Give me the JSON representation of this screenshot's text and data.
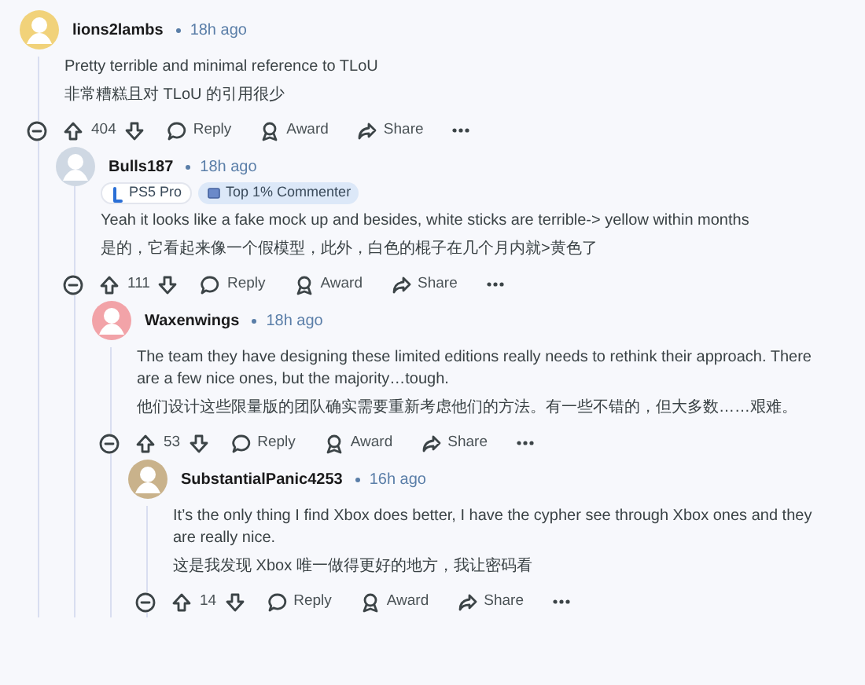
{
  "comments": [
    {
      "author": "lions2lambs",
      "time": "18h ago",
      "paragraphs": [
        "Pretty terrible and minimal reference to TLoU",
        "非常糟糕且对 TLoU 的引用很少"
      ],
      "score": "404",
      "actions": [
        "Reply",
        "Award",
        "Share"
      ],
      "children": [
        {
          "author": "Bulls187",
          "time": "18h ago",
          "badges": [
            {
              "kind": "flair",
              "label": "PS5 Pro"
            },
            {
              "kind": "achievement",
              "label": "Top 1% Commenter"
            }
          ],
          "paragraphs": [
            "Yeah it looks like a fake mock up and besides, white sticks are terrible-> yellow within months",
            "是的，它看起来像一个假模型，此外，白色的棍子在几个月内就>黄色了"
          ],
          "score": "111",
          "actions": [
            "Reply",
            "Award",
            "Share"
          ],
          "children": [
            {
              "author": "Waxenwings",
              "time": "18h ago",
              "paragraphs": [
                "The team they have designing these limited editions really needs to rethink their approach. There are a few nice ones, but the majority…tough.",
                "他们设计这些限量版的团队确实需要重新考虑他们的方法。有一些不错的，但大多数……艰难。"
              ],
              "score": "53",
              "actions": [
                "Reply",
                "Award",
                "Share"
              ],
              "children": [
                {
                  "author": "SubstantialPanic4253",
                  "time": "16h ago",
                  "paragraphs": [
                    "It’s the only thing I find Xbox does better, I have the cypher see through Xbox ones and they are really nice.",
                    "这是我发现 Xbox 唯一做得更好的地方，我让密码看"
                  ],
                  "score": "14",
                  "actions": [
                    "Reply",
                    "Award",
                    "Share"
                  ]
                }
              ]
            }
          ]
        }
      ]
    }
  ]
}
